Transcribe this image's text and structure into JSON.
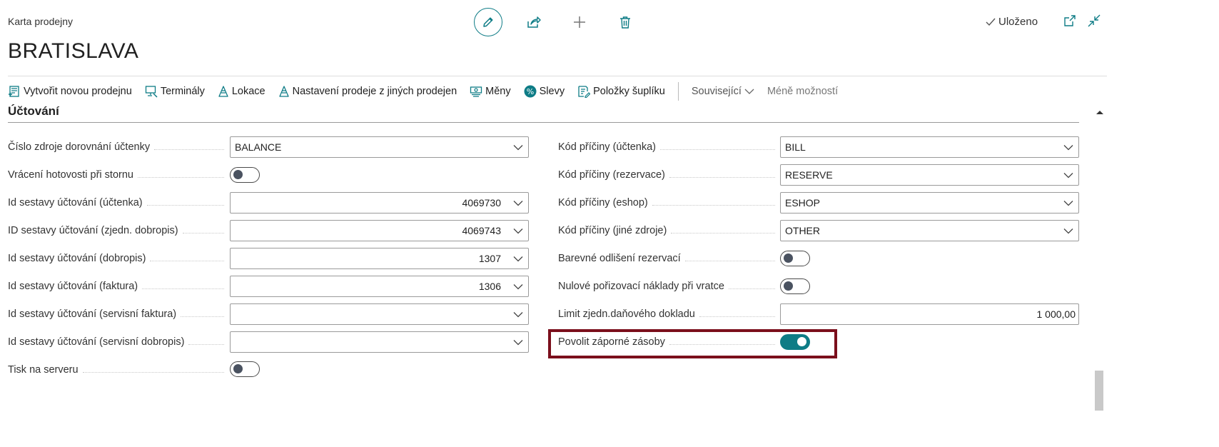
{
  "header": {
    "caption": "Karta prodejny",
    "title": "BRATISLAVA",
    "saved_status": "Uloženo"
  },
  "actions": [
    {
      "label": "Vytvořit novou prodejnu",
      "icon": "new-store-icon"
    },
    {
      "label": "Terminály",
      "icon": "terminal-icon"
    },
    {
      "label": "Lokace",
      "icon": "location-icon"
    },
    {
      "label": "Nastavení prodeje z jiných prodejen",
      "icon": "location-icon"
    },
    {
      "label": "Měny",
      "icon": "currency-icon"
    },
    {
      "label": "Slevy",
      "icon": "percent-icon"
    },
    {
      "label": "Položky šuplíku",
      "icon": "drawer-items-icon"
    },
    {
      "label": "Související",
      "icon": "chevron-down-icon"
    },
    {
      "label": "Méně možností",
      "icon": ""
    }
  ],
  "section": {
    "title": "Účtování"
  },
  "left_fields": [
    {
      "label": "Číslo zdroje dorovnání účtenky",
      "type": "select",
      "value": "BALANCE"
    },
    {
      "label": "Vrácení hotovosti při stornu",
      "type": "toggle",
      "on": false
    },
    {
      "label": "Id sestavy účtování (účtenka)",
      "type": "select-num",
      "value": "4069730"
    },
    {
      "label": "ID sestavy účtování (zjedn. dobropis)",
      "type": "select-num",
      "value": "4069743"
    },
    {
      "label": "Id sestavy účtování (dobropis)",
      "type": "select-num",
      "value": "1307"
    },
    {
      "label": "Id sestavy účtování (faktura)",
      "type": "select-num",
      "value": "1306"
    },
    {
      "label": "Id sestavy účtování (servisní faktura)",
      "type": "select",
      "value": ""
    },
    {
      "label": "Id sestavy účtování (servisní dobropis)",
      "type": "select",
      "value": ""
    },
    {
      "label": "Tisk na serveru",
      "type": "toggle",
      "on": false
    }
  ],
  "right_fields": [
    {
      "label": "Kód příčiny (účtenka)",
      "type": "select",
      "value": "BILL"
    },
    {
      "label": "Kód příčiny (rezervace)",
      "type": "select",
      "value": "RESERVE"
    },
    {
      "label": "Kód příčiny (eshop)",
      "type": "select",
      "value": "ESHOP"
    },
    {
      "label": "Kód příčiny (jiné zdroje)",
      "type": "select",
      "value": "OTHER"
    },
    {
      "label": "Barevné odlišení rezervací",
      "type": "toggle",
      "on": false
    },
    {
      "label": "Nulové pořizovací náklady při vratce",
      "type": "toggle",
      "on": false
    },
    {
      "label": "Limit zjedn.daňového dokladu",
      "type": "number",
      "value": "1 000,00"
    },
    {
      "label": "Povolit záporné zásoby",
      "type": "toggle",
      "on": true
    }
  ],
  "colors": {
    "accent": "#0e7c86",
    "highlight": "#7b0f1c"
  }
}
